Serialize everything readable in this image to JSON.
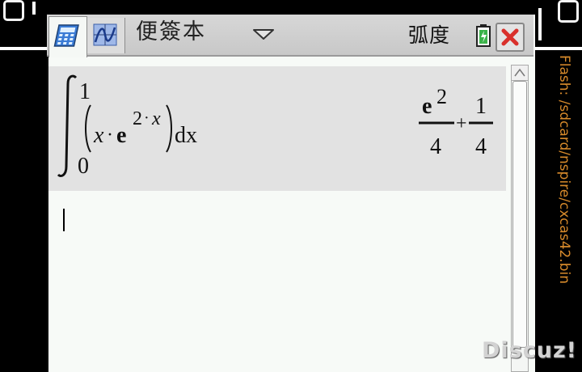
{
  "toolbar": {
    "document_title": "便簽本",
    "angle_mode": "弧度",
    "tabs": [
      {
        "name": "calculator",
        "icon": "calculator-icon"
      },
      {
        "name": "graphs",
        "icon": "graph-icon"
      }
    ]
  },
  "history": {
    "entries": [
      {
        "input": {
          "integral_sign": "∫",
          "upper_limit": "1",
          "lower_limit": "0",
          "paren_open": "(",
          "paren_close": ")",
          "x": "x",
          "dot": "·",
          "e": "e",
          "exponent_two": "2",
          "exponent_x": "x",
          "dx": "dx"
        },
        "result": {
          "num1_e": "e",
          "num1_pow": "2",
          "den1": "4",
          "plus": "+",
          "num2": "1",
          "den2": "4"
        }
      }
    ]
  },
  "side_label": "Flash: /sdcard/nspire/cxcas42.bin",
  "watermark": "Discuz!",
  "colors": {
    "side_label": "#d78a2b",
    "close_x": "#d9302b",
    "battery_fill": "#3bb34a"
  }
}
